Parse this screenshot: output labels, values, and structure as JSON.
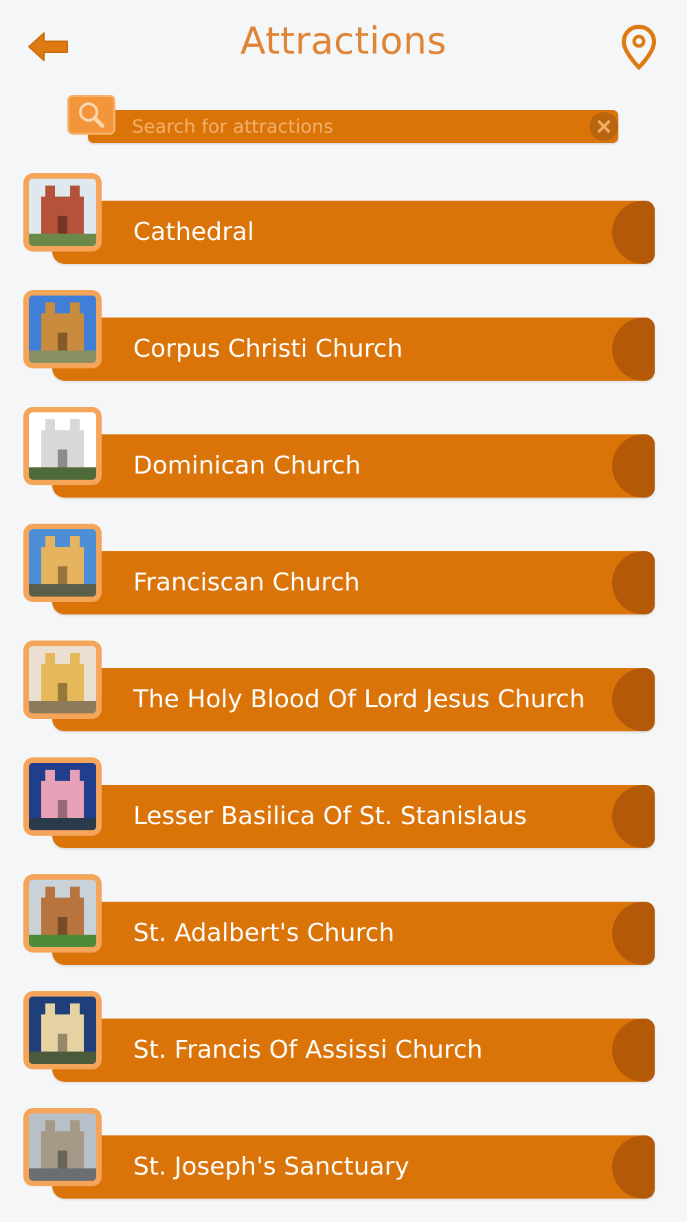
{
  "header": {
    "title": "Attractions",
    "back_icon": "back-arrow-icon",
    "map_icon": "map-pin-icon"
  },
  "search": {
    "placeholder": "Search for attractions",
    "value": ""
  },
  "colors": {
    "accent": "#da7409",
    "accent_dark": "#b35907",
    "thumb_frame": "#f4a55a",
    "title": "#df8334",
    "background": "#f5f6f8"
  },
  "attractions": [
    {
      "name": "Cathedral"
    },
    {
      "name": "Corpus Christi Church"
    },
    {
      "name": "Dominican Church"
    },
    {
      "name": "Franciscan Church"
    },
    {
      "name": "The Holy Blood Of Lord Jesus Church"
    },
    {
      "name": "Lesser Basilica Of St. Stanislaus"
    },
    {
      "name": "St. Adalbert's Church"
    },
    {
      "name": "St. Francis Of Assissi Church"
    },
    {
      "name": "St. Joseph's Sanctuary"
    }
  ]
}
